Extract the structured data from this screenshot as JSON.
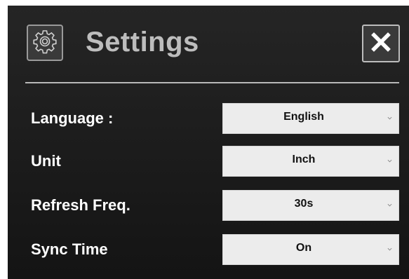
{
  "dialog": {
    "title": "Settings",
    "icons": {
      "settings": "gear-icon",
      "close": "close-icon",
      "dropdown": "chevron-down-icon"
    }
  },
  "settings": [
    {
      "label": "Language :",
      "value": "English"
    },
    {
      "label": "Unit",
      "value": "Inch"
    },
    {
      "label": "Refresh Freq.",
      "value": "30s"
    },
    {
      "label": "Sync Time",
      "value": "On"
    }
  ],
  "colors": {
    "panel_top": "#252525",
    "panel_bottom": "#141414",
    "title_text": "#bdbdbd",
    "label_text": "#ffffff",
    "select_bg": "#ececec",
    "divider": "#b8b8b8"
  }
}
